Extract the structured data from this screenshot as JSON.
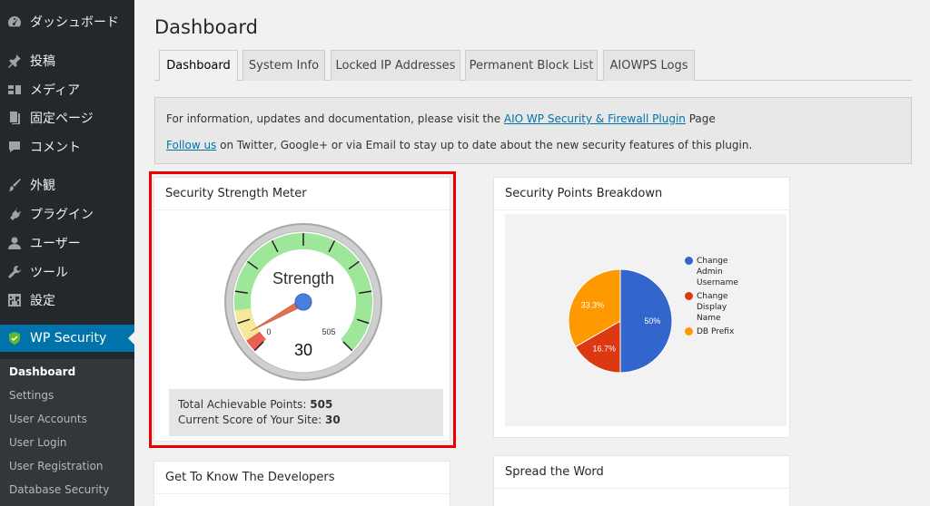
{
  "sidebar": {
    "items": [
      {
        "label": "ダッシュボード",
        "icon": "dashboard-icon"
      },
      {
        "label": "投稿",
        "icon": "pin-icon"
      },
      {
        "label": "メディア",
        "icon": "media-icon"
      },
      {
        "label": "固定ページ",
        "icon": "pages-icon"
      },
      {
        "label": "コメント",
        "icon": "comment-icon"
      },
      {
        "label": "外観",
        "icon": "brush-icon"
      },
      {
        "label": "プラグイン",
        "icon": "plugin-icon"
      },
      {
        "label": "ユーザー",
        "icon": "user-icon"
      },
      {
        "label": "ツール",
        "icon": "wrench-icon"
      },
      {
        "label": "設定",
        "icon": "settings-icon"
      },
      {
        "label": "WP Security",
        "icon": "shield-icon"
      }
    ],
    "submenu": [
      "Dashboard",
      "Settings",
      "User Accounts",
      "User Login",
      "User Registration",
      "Database Security"
    ]
  },
  "page": {
    "title": "Dashboard"
  },
  "tabs": [
    "Dashboard",
    "System Info",
    "Locked IP Addresses",
    "Permanent Block List",
    "AIOWPS Logs"
  ],
  "info": {
    "line1_prefix": "For information, updates and documentation, please visit the",
    "line1_link": "AIO WP Security & Firewall Plugin",
    "line1_suffix": "Page",
    "line2_link": "Follow us",
    "line2_suffix": "on Twitter, Google+ or via Email to stay up to date about the new security features of this plugin."
  },
  "meter": {
    "title": "Security Strength Meter",
    "gauge_label": "Strength",
    "min_label": "0",
    "max_label": "505",
    "score_display": "30",
    "score": 30,
    "max": 505,
    "total_label": "Total Achievable Points:",
    "total_value": "505",
    "current_label": "Current Score of Your Site:",
    "current_value": "30"
  },
  "breakdown": {
    "title": "Security Points Breakdown"
  },
  "chart_data": {
    "type": "pie",
    "categories": [
      "Change Admin Username",
      "Change Display Name",
      "DB Prefix"
    ],
    "values": [
      50,
      16.7,
      33.3
    ],
    "slice_labels": [
      "50%",
      "16.7%",
      "33.3%"
    ],
    "colors": [
      "#3366cc",
      "#dc3912",
      "#ff9900"
    ],
    "legend": "right",
    "legend_lines": [
      [
        "Change",
        "Admin",
        "Username"
      ],
      [
        "Change",
        "Display",
        "Name"
      ],
      [
        "DB Prefix"
      ]
    ]
  },
  "developers": {
    "title": "Get To Know The Developers"
  },
  "spread": {
    "title": "Spread the Word"
  }
}
